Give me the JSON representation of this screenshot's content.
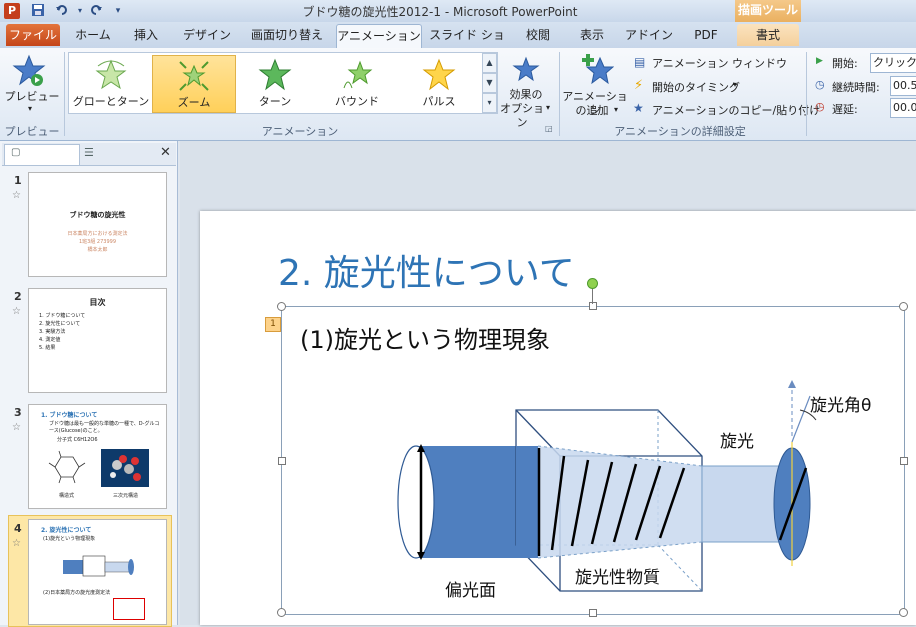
{
  "window": {
    "app_icon": "P",
    "title": "ブドウ糖の旋光性2012-1 - Microsoft PowerPoint",
    "contextual_group": "描画ツール"
  },
  "qat": {
    "save_icon": "save-icon",
    "undo_icon": "undo-icon",
    "redo_icon": "redo-icon",
    "customize_icon": "dropdown-icon"
  },
  "tabs": [
    "ファイル",
    "ホーム",
    "挿入",
    "デザイン",
    "画面切り替え",
    "アニメーション",
    "スライド ショー",
    "校閲",
    "表示",
    "アドイン",
    "PDF",
    "書式"
  ],
  "ribbon": {
    "preview": {
      "label": "プレビュー",
      "group_label": "プレビュー"
    },
    "animations": {
      "group_label": "アニメーション",
      "gallery": [
        {
          "label": "グローとターン",
          "selected": false
        },
        {
          "label": "ズーム",
          "selected": true
        },
        {
          "label": "ターン",
          "selected": false
        },
        {
          "label": "バウンド",
          "selected": false
        },
        {
          "label": "パルス",
          "selected": false
        }
      ],
      "effect_options_line1": "効果の",
      "effect_options_line2": "オプション"
    },
    "advanced": {
      "group_label": "アニメーションの詳細設定",
      "add_animation_line1": "アニメーション",
      "add_animation_line2": "の追加",
      "animation_pane": "アニメーション ウィンドウ",
      "trigger": "開始のタイミング",
      "painter": "アニメーションのコピー/貼り付け"
    },
    "timing": {
      "start_label": "開始:",
      "start_value": "クリック時",
      "duration_label": "継続時間:",
      "duration_value": "00.5",
      "delay_label": "遅延:",
      "delay_value": "00.0"
    }
  },
  "slides": [
    {
      "num": "1",
      "title": "ブドウ糖の旋光性",
      "lines": [
        "日本薬局方における測定法",
        "1班3組 273999",
        "橋本太郎"
      ]
    },
    {
      "num": "2",
      "title": "目次",
      "lines": [
        "1. ブドウ糖について",
        "2. 旋光性について",
        "3. 実験方法",
        "4. 測定値",
        "5. 結果"
      ]
    },
    {
      "num": "3",
      "title": "1. ブドウ糖について",
      "lines": [
        "ブドウ糖は最も一般的な単糖の一種で、D-グルコース(Glucose)のこと。",
        "分子式 C6H12O6"
      ],
      "captions": [
        "構造式",
        "三次元構造"
      ]
    },
    {
      "num": "4",
      "title": "2. 旋光性について",
      "lines": [
        "(1)旋光という物理現象",
        "(2)日本薬局方の旋光度測定法"
      ]
    }
  ],
  "slide": {
    "title": "2. 旋光性について",
    "subtitle": "(1)旋光という物理現象",
    "animation_tag": "1",
    "labels": {
      "polarizing_plane": "偏光面",
      "optical_material": "旋光性物質",
      "optical_rotation": "旋光",
      "rotation_angle": "旋光角θ"
    }
  },
  "colors": {
    "accent_file": "#c4461a",
    "title_blue": "#2e74b5",
    "cylinder": "#4f7fbf",
    "selection": "#ffd05a"
  }
}
